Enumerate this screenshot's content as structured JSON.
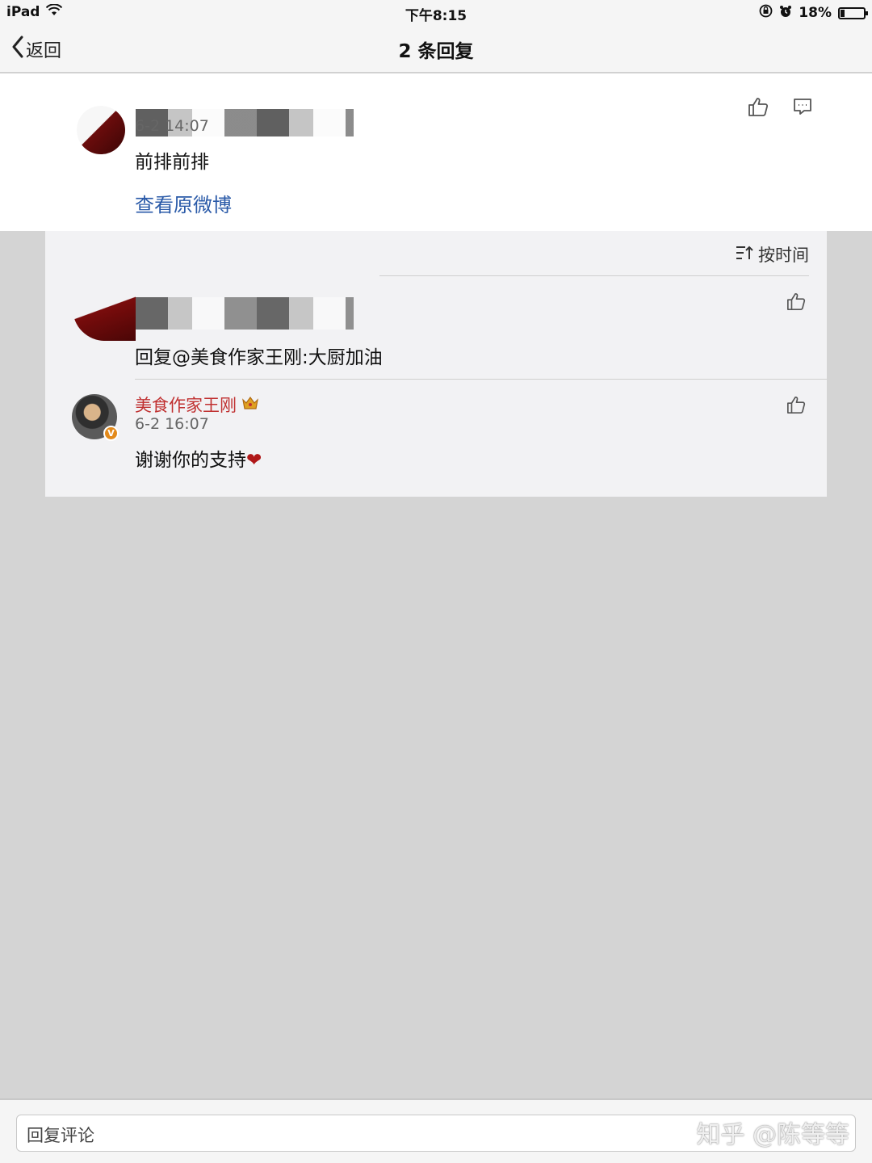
{
  "status_bar": {
    "device": "iPad",
    "time": "下午8:15",
    "battery": "18%",
    "battery_level": 0.18
  },
  "nav": {
    "back_label": "返回",
    "title": "2 条回复"
  },
  "original_comment": {
    "time": "6-2 14:07",
    "content": "前排前排",
    "view_original_label": "查看原微博"
  },
  "replies": {
    "sort_label": "按时间",
    "items": [
      {
        "content": "回复@美食作家王刚:大厨加油"
      },
      {
        "username": "美食作家王刚",
        "time": "6-2 16:07",
        "content": "谢谢你的支持",
        "badge": "V"
      }
    ]
  },
  "bottom": {
    "reply_placeholder": "回复评论",
    "watermark": "知乎 @陈等等"
  },
  "colors": {
    "link": "#2a5aa8",
    "username": "#c03030",
    "background": "#d4d4d4"
  }
}
